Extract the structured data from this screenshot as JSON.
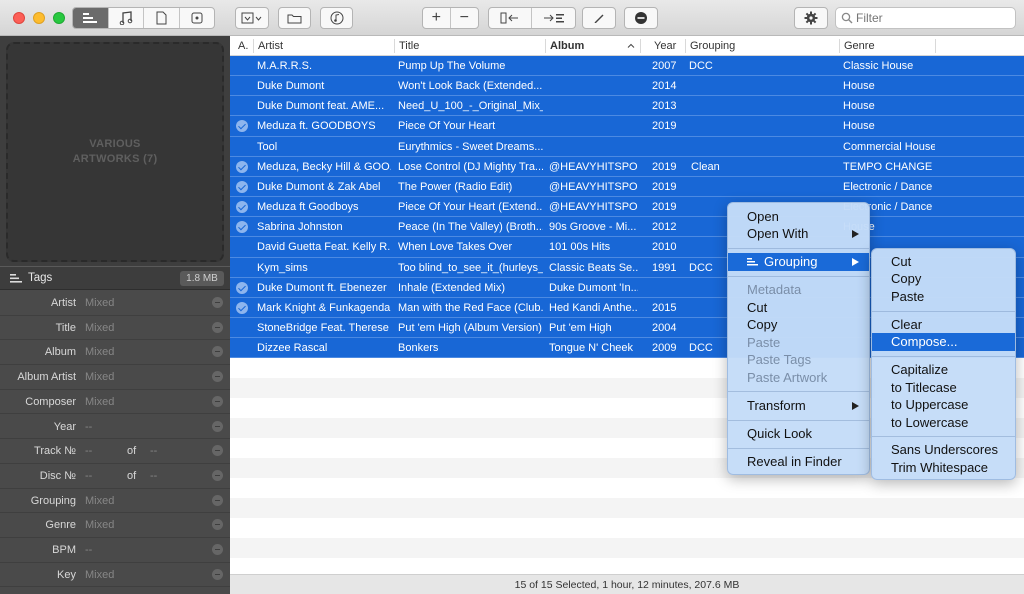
{
  "toolbar": {
    "filter_placeholder": "Filter",
    "view_buttons": [
      "tag-editor-view",
      "artwork-view",
      "text-view",
      "file-view"
    ]
  },
  "artwork": {
    "line1": "VARIOUS",
    "line2": "ARTWORKS (7)"
  },
  "tags_panel": {
    "title": "Tags",
    "size": "1.8 MB",
    "fields": [
      {
        "label": "Artist",
        "value": "Mixed"
      },
      {
        "label": "Title",
        "value": "Mixed"
      },
      {
        "label": "Album",
        "value": "Mixed"
      },
      {
        "label": "Album Artist",
        "value": "Mixed"
      },
      {
        "label": "Composer",
        "value": "Mixed"
      },
      {
        "label": "Year",
        "value": "--"
      },
      {
        "label": "Track №",
        "value": "--",
        "of_label": "of",
        "of_value": "--"
      },
      {
        "label": "Disc №",
        "value": "--",
        "of_label": "of",
        "of_value": "--"
      },
      {
        "label": "Grouping",
        "value": "Mixed"
      },
      {
        "label": "Genre",
        "value": "Mixed"
      },
      {
        "label": "BPM",
        "value": "--"
      },
      {
        "label": "Key",
        "value": "Mixed"
      }
    ]
  },
  "table": {
    "columns": [
      "A.",
      "Artist",
      "Title",
      "Album",
      "Year",
      "Grouping",
      "Genre"
    ],
    "rows": [
      {
        "checked": false,
        "artist": "M.A.R.R.S.",
        "title": "Pump Up The Volume",
        "album": "",
        "year": "2007",
        "grouping": "DCC",
        "genre": "Classic House"
      },
      {
        "checked": false,
        "artist": "Duke Dumont",
        "title": "Won't Look Back (Extended...",
        "album": "",
        "year": "2014",
        "grouping": "",
        "genre": "House"
      },
      {
        "checked": false,
        "artist": "Duke Dumont feat. AME...",
        "title": "Need_U_100_-_Original_Mix_-...",
        "album": "",
        "year": "2013",
        "grouping": "",
        "genre": "House"
      },
      {
        "checked": true,
        "artist": "Meduza ft. GOODBOYS",
        "title": "Piece Of Your Heart",
        "album": "",
        "year": "2019",
        "grouping": "",
        "genre": "House"
      },
      {
        "checked": false,
        "artist": "Tool",
        "title": "Eurythmics - Sweet Dreams...",
        "album": "",
        "year": "",
        "grouping": "",
        "genre": "Commercial House"
      },
      {
        "checked": true,
        "artist": "Meduza, Becky Hill & GOO...",
        "title": "Lose Control (DJ Mighty Tra...",
        "album": "@HEAVYHITSPO...",
        "year": "2019",
        "grouping": "Clean",
        "genre": "TEMPO CHANGE"
      },
      {
        "checked": true,
        "artist": "Duke Dumont & Zak Abel",
        "title": "The Power (Radio Edit)",
        "album": "@HEAVYHITSPO...",
        "year": "2019",
        "grouping": "",
        "genre": "Electronic / Dance"
      },
      {
        "checked": true,
        "artist": "Meduza ft Goodboys",
        "title": "Piece Of Your Heart (Extend...",
        "album": "@HEAVYHITSPO...",
        "year": "2019",
        "grouping": "",
        "genre": "Electronic / Dance"
      },
      {
        "checked": true,
        "artist": "Sabrina Johnston",
        "title": "Peace (In The Valley) (Broth...",
        "album": "90s Groove - Mi...",
        "year": "2012",
        "grouping": "",
        "genre": "House"
      },
      {
        "checked": false,
        "artist": "David Guetta Feat. Kelly R...",
        "title": "When Love Takes Over",
        "album": "101 00s Hits",
        "year": "2010",
        "grouping": "",
        "genre": ""
      },
      {
        "checked": false,
        "artist": "Kym_sims",
        "title": "Too blind_to_see_it_(hurleys_...",
        "album": "Classic Beats Se...",
        "year": "1991",
        "grouping": "DCC",
        "genre": ""
      },
      {
        "checked": true,
        "artist": "Duke Dumont ft. Ebenezer",
        "title": "Inhale (Extended Mix)",
        "album": "Duke Dumont 'In...",
        "year": "",
        "grouping": "",
        "genre": ""
      },
      {
        "checked": true,
        "artist": "Mark Knight & Funkagenda",
        "title": "Man with the Red Face (Club...",
        "album": "Hed Kandi Anthe...",
        "year": "2015",
        "grouping": "",
        "genre": ""
      },
      {
        "checked": false,
        "artist": "StoneBridge Feat. Therese",
        "title": "Put 'em High (Album Version)",
        "album": "Put 'em High",
        "year": "2004",
        "grouping": "",
        "genre": ""
      },
      {
        "checked": false,
        "artist": "Dizzee Rascal",
        "title": "Bonkers",
        "album": "Tongue N' Cheek",
        "year": "2009",
        "grouping": "DCC",
        "genre": ""
      }
    ]
  },
  "status": "15 of 15 Selected, 1 hour, 12 minutes, 207.6 MB",
  "context_menu": {
    "open": "Open",
    "open_with": "Open With",
    "grouping": "Grouping",
    "metadata": "Metadata",
    "cut": "Cut",
    "copy": "Copy",
    "paste": "Paste",
    "paste_tags": "Paste Tags",
    "paste_artwork": "Paste Artwork",
    "transform": "Transform",
    "quick_look": "Quick Look",
    "reveal": "Reveal in Finder"
  },
  "submenu": {
    "cut": "Cut",
    "copy": "Copy",
    "paste": "Paste",
    "clear": "Clear",
    "compose": "Compose...",
    "capitalize": "Capitalize",
    "titlecase": "to Titlecase",
    "uppercase": "to Uppercase",
    "lowercase": "to Lowercase",
    "sans_underscores": "Sans Underscores",
    "trim_whitespace": "Trim Whitespace"
  },
  "colors": {
    "selection": "#1867d6",
    "menu_highlight": "#1a6ad8"
  }
}
